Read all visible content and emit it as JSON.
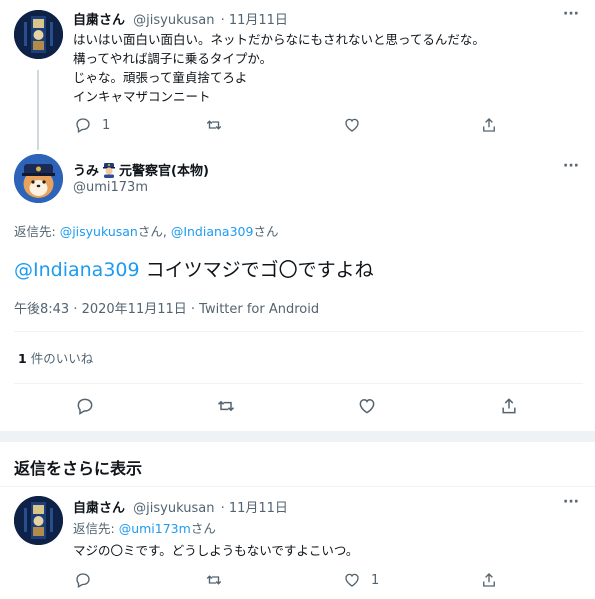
{
  "tweet1": {
    "name": "自粛さん",
    "handle": "@jisyukusan",
    "date": "· 11月11日",
    "lines": [
      "はいはい面白い面白い。ネットだからなにもされないと思ってるんだな。",
      "構ってやれば調子に乗るタイプか。",
      "じゃな。頑張って童貞捨てろよ",
      "インキャマザコンニート"
    ],
    "reply_count": "1"
  },
  "main": {
    "name": "うみ",
    "name_suffix": "元警察官(本物)",
    "handle": "@umi173m",
    "reply_to_label": "返信先:",
    "reply_to_user1": "@jisyukusan",
    "reply_to_san1": "さん,",
    "reply_to_user2": "@Indiana309",
    "reply_to_san2": "さん",
    "mention": "@Indiana309",
    "text": "コイツマジでゴ〇ですよね",
    "meta": "午後8:43 · 2020年11月11日 · Twitter for Android",
    "likes_count": "1",
    "likes_label": "件のいいね"
  },
  "more_replies": {
    "title": "返信をさらに表示"
  },
  "tweet3": {
    "name": "自粛さん",
    "handle": "@jisyukusan",
    "date": "· 11月11日",
    "reply_to_label": "返信先:",
    "reply_to_user": "@umi173m",
    "reply_to_san": "さん",
    "text": "マジの〇ミです。どうしようもないですよこいつ。",
    "like_count": "1"
  },
  "icons": {
    "more": "more-icon",
    "reply": "reply-icon",
    "retweet": "retweet-icon",
    "like": "heart-icon",
    "share": "share-icon",
    "police": "police-officer-emoji"
  },
  "colors": {
    "link": "#1d9bf0",
    "muted": "#536471",
    "divider": "#eff3f4",
    "section_gap": "#f7f9f9"
  }
}
